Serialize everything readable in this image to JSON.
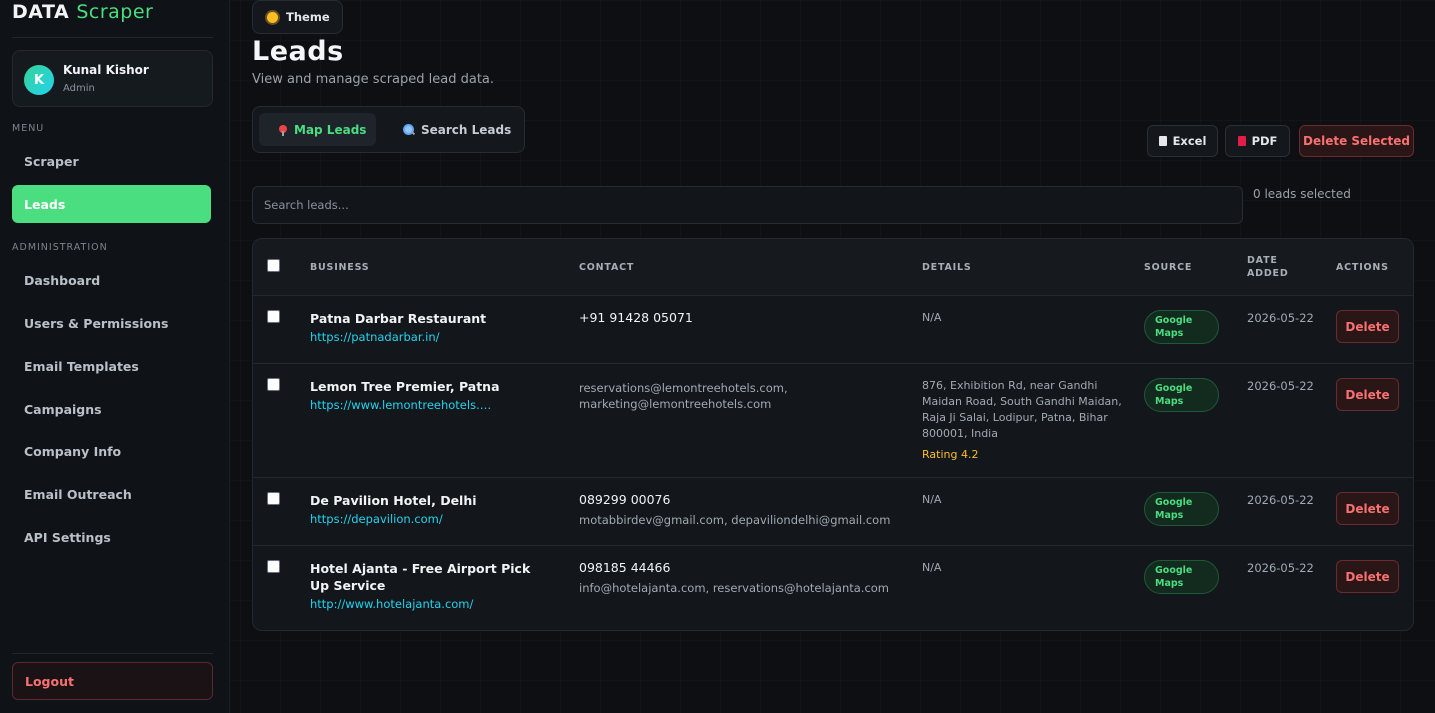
{
  "brand": {
    "prefix": "DATA",
    "accent": "Scraper"
  },
  "user": {
    "initial": "K",
    "name": "Kunal Kishor",
    "role": "Admin"
  },
  "sidebar": {
    "menu_label": "MENU",
    "menu_items": [
      {
        "label": "Scraper"
      },
      {
        "label": "Leads",
        "active": true
      }
    ],
    "admin_label": "ADMINISTRATION",
    "admin_items": [
      {
        "label": "Dashboard"
      },
      {
        "label": "Users & Permissions"
      },
      {
        "label": "Email Templates"
      },
      {
        "label": "Campaigns"
      },
      {
        "label": "Company Info"
      },
      {
        "label": "Email Outreach"
      },
      {
        "label": "API Settings"
      }
    ],
    "logout_label": "Logout"
  },
  "theme_button": {
    "label": "Theme",
    "icon": "sun-icon"
  },
  "page": {
    "title": "Leads",
    "subtitle": "View and manage scraped lead data."
  },
  "tabs": [
    {
      "label": "Map Leads",
      "icon": "pin-icon",
      "active": true
    },
    {
      "label": "Search Leads",
      "icon": "magnifier-icon",
      "active": false
    }
  ],
  "toolbar": {
    "excel_label": "Excel",
    "pdf_label": "PDF",
    "delete_selected_label": "Delete Selected"
  },
  "search": {
    "placeholder": "Search leads...",
    "value": ""
  },
  "selected_count": "0 leads selected",
  "table": {
    "columns": [
      "BUSINESS",
      "CONTACT",
      "DETAILS",
      "SOURCE",
      "DATE ADDED",
      "ACTIONS"
    ],
    "rows": [
      {
        "business": "Patna Darbar Restaurant",
        "website": "https://patnadarbar.in/",
        "phone": "+91 91428 05071",
        "email": "",
        "details": "N/A",
        "rating": "",
        "source": "Google Maps",
        "date": "2026-05-22",
        "action": "Delete"
      },
      {
        "business": "Lemon Tree Premier, Patna",
        "website": "https://www.lemontreehotels.co...",
        "phone": "",
        "email": "reservations@lemontreehotels.com, marketing@lemontreehotels.com",
        "details": "876, Exhibition Rd, near Gandhi Maidan Road, South Gandhi Maidan, Raja Ji Salai, Lodipur, Patna, Bihar 800001, India",
        "rating": "Rating 4.2",
        "source": "Google Maps",
        "date": "2026-05-22",
        "action": "Delete"
      },
      {
        "business": "De Pavilion Hotel, Delhi",
        "website": "https://depavilion.com/",
        "phone": "089299 00076",
        "email": "motabbirdev@gmail.com, depaviliondelhi@gmail.com",
        "details": "N/A",
        "rating": "",
        "source": "Google Maps",
        "date": "2026-05-22",
        "action": "Delete"
      },
      {
        "business": "Hotel Ajanta - Free Airport Pick Up Service",
        "website": "http://www.hotelajanta.com/",
        "phone": "098185 44466",
        "email": "info@hotelajanta.com, reservations@hotelajanta.com",
        "details": "N/A",
        "rating": "",
        "source": "Google Maps",
        "date": "2026-05-22",
        "action": "Delete"
      }
    ]
  }
}
